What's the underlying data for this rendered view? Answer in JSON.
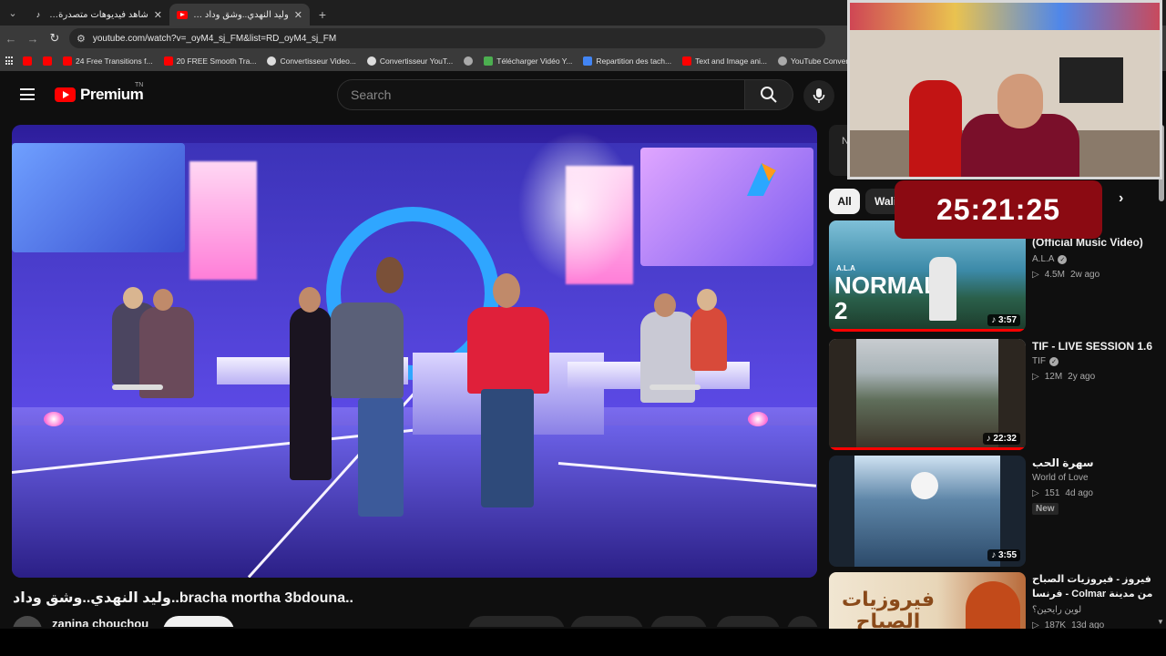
{
  "browser": {
    "tabs": [
      {
        "title": "شاهد فيديوهات متصدرة (99+)",
        "favicon": "tiktok-icon",
        "active": false
      },
      {
        "title": "وليد النهدي..وشق وداد (3) - YouTube",
        "favicon": "youtube-icon",
        "active": true
      }
    ],
    "url": "youtube.com/watch?v=_oyM4_sj_FM&list=RD_oyM4_sj_FM",
    "bookmarks": [
      {
        "label": "",
        "icon": "youtube-icon",
        "color": "#ff0000"
      },
      {
        "label": "",
        "icon": "youtube-icon",
        "color": "#ff0000"
      },
      {
        "label": "24 Free Transitions f...",
        "icon": "youtube-icon",
        "color": "#ff0000"
      },
      {
        "label": "20 FREE Smooth Tra...",
        "icon": "youtube-icon",
        "color": "#ff0000"
      },
      {
        "label": "Convertisseur Video...",
        "icon": "chrome-icon",
        "color": "#dddddd"
      },
      {
        "label": "Convertisseur YouT...",
        "icon": "chrome-icon",
        "color": "#dddddd"
      },
      {
        "label": "",
        "icon": "globe-icon",
        "color": "#aaaaaa"
      },
      {
        "label": "Télécharger Vidéo Y...",
        "icon": "download-icon",
        "color": "#4caf50"
      },
      {
        "label": "Repartition des tach...",
        "icon": "docs-icon",
        "color": "#4285f4"
      },
      {
        "label": "Text and Image ani...",
        "icon": "youtube-icon",
        "color": "#ff0000"
      },
      {
        "label": "YouTube Converter...",
        "icon": "globe-icon",
        "color": "#aaaaaa"
      }
    ]
  },
  "youtube": {
    "logo_text": "Premium",
    "logo_suffix": "TN",
    "search_placeholder": "Search",
    "video_title": "وليد النهدي..وشق وداد..bracha mortha 3bdouna..",
    "channel_name": "zanina chouchou",
    "chips": [
      "All",
      "Wali"
    ],
    "recommendations": [
      {
        "title": "A.L.A - Normal 2 (Official Music Video)",
        "title_visible": "2\n(Official Music Video)",
        "channel": "A.L.A",
        "verified": true,
        "views": "4.5M",
        "age": "2w ago",
        "duration": "3:57",
        "progress": 1.0,
        "new": false,
        "thumb_text": "NORMAL 2"
      },
      {
        "title": "TIF - LIVE SESSION 1.6",
        "channel": "TIF",
        "verified": true,
        "views": "12M",
        "age": "2y ago",
        "duration": "22:32",
        "progress": 1.0,
        "new": false
      },
      {
        "title": "سهرة الحب",
        "channel": "World of Love",
        "verified": false,
        "views": "151",
        "age": "4d ago",
        "duration": "3:55",
        "progress": 0,
        "new": true,
        "new_label": "New"
      },
      {
        "title": "فيروز - فيروزيات الصباح من مدينة Colmar - فرنسا",
        "channel": "لوين رايحين؟",
        "verified": false,
        "views": "187K",
        "age": "13d ago",
        "duration": "",
        "progress": 0,
        "new": false,
        "thumb_text": "فيروزيات الصباح"
      }
    ]
  },
  "overlay": {
    "timer": "25:21:25"
  }
}
